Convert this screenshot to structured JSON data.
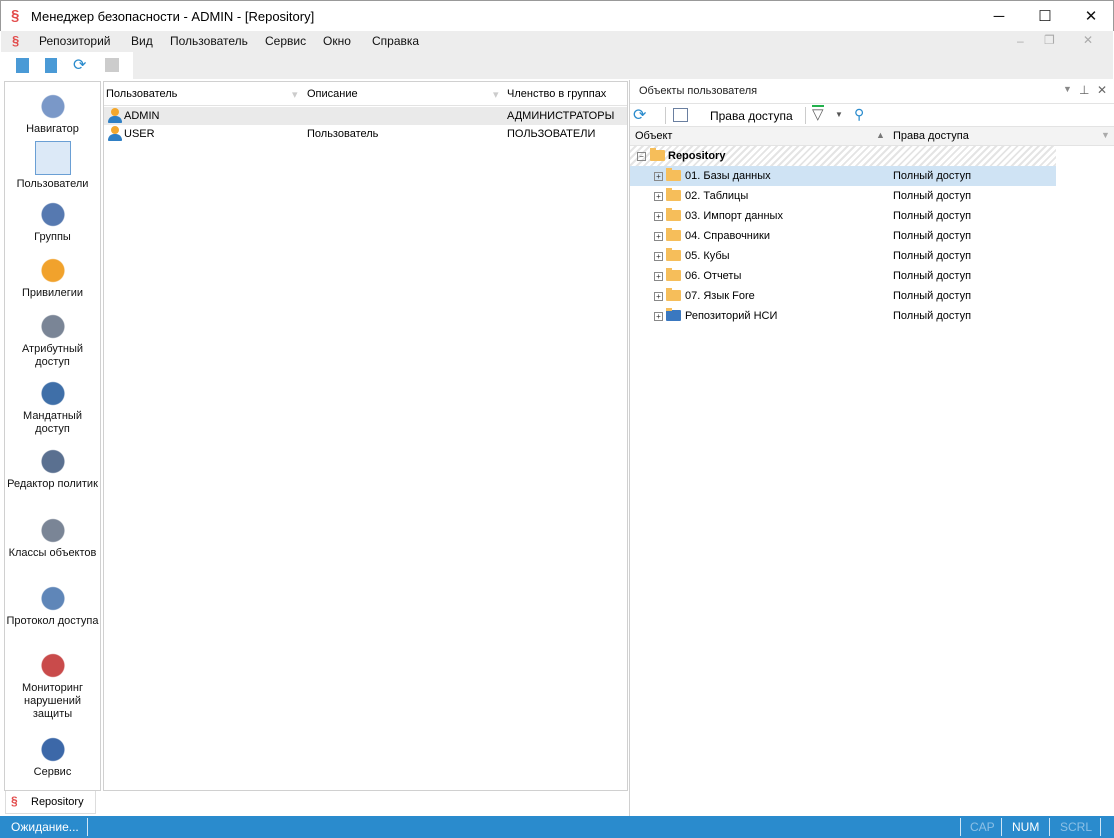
{
  "window": {
    "title": "Менеджер безопасности - ADMIN - [Repository]",
    "minimize": "─",
    "maximize": "☐",
    "close": "✕"
  },
  "menu": [
    "Репозиторий",
    "Вид",
    "Пользователь",
    "Сервис",
    "Окно",
    "Справка"
  ],
  "sidebar": [
    {
      "label": "Навигатор",
      "icon": "navigator-icon"
    },
    {
      "label": "Пользователи",
      "icon": "users-icon",
      "selected": true
    },
    {
      "label": "Группы",
      "icon": "groups-icon"
    },
    {
      "label": "Привилегии",
      "icon": "key-icon"
    },
    {
      "label": "Атрибутный доступ",
      "icon": "attribute-access-icon"
    },
    {
      "label": "Мандатный доступ",
      "icon": "mandatory-access-icon"
    },
    {
      "label": "Редактор политик",
      "icon": "policy-editor-icon"
    },
    {
      "label": "Классы объектов",
      "icon": "object-classes-icon"
    },
    {
      "label": "Протокол доступа",
      "icon": "access-log-icon"
    },
    {
      "label": "Мониторинг нарушений защиты",
      "icon": "security-monitoring-icon"
    },
    {
      "label": "Сервис",
      "icon": "service-gear-icon"
    }
  ],
  "users_table": {
    "columns": [
      "Пользователь",
      "Описание",
      "Членство в группах"
    ],
    "rows": [
      {
        "user": "ADMIN",
        "description": "",
        "groups": "АДМИНИСТРАТОРЫ"
      },
      {
        "user": "USER",
        "description": "Пользователь",
        "groups": "ПОЛЬЗОВАТЕЛИ"
      }
    ]
  },
  "doc_tab": "Repository",
  "objects_panel": {
    "title": "Объекты пользователя",
    "toolbar": {
      "access_rights": "Права доступа"
    },
    "columns": [
      "Объект",
      "Права доступа"
    ],
    "root": "Repository",
    "items": [
      {
        "name": "01. Базы данных",
        "access": "Полный доступ",
        "selected": true
      },
      {
        "name": "02. Таблицы",
        "access": "Полный доступ"
      },
      {
        "name": "03. Импорт данных",
        "access": "Полный доступ"
      },
      {
        "name": "04. Справочники",
        "access": "Полный доступ"
      },
      {
        "name": "05. Кубы",
        "access": "Полный доступ"
      },
      {
        "name": "06. Отчеты",
        "access": "Полный доступ"
      },
      {
        "name": "07. Язык Fore",
        "access": "Полный доступ"
      },
      {
        "name": "Репозиторий НСИ",
        "access": "Полный доступ",
        "nsi": true
      }
    ]
  },
  "status": {
    "text": "Ожидание...",
    "cap": "CAP",
    "num": "NUM",
    "scrl": "SCRL"
  }
}
